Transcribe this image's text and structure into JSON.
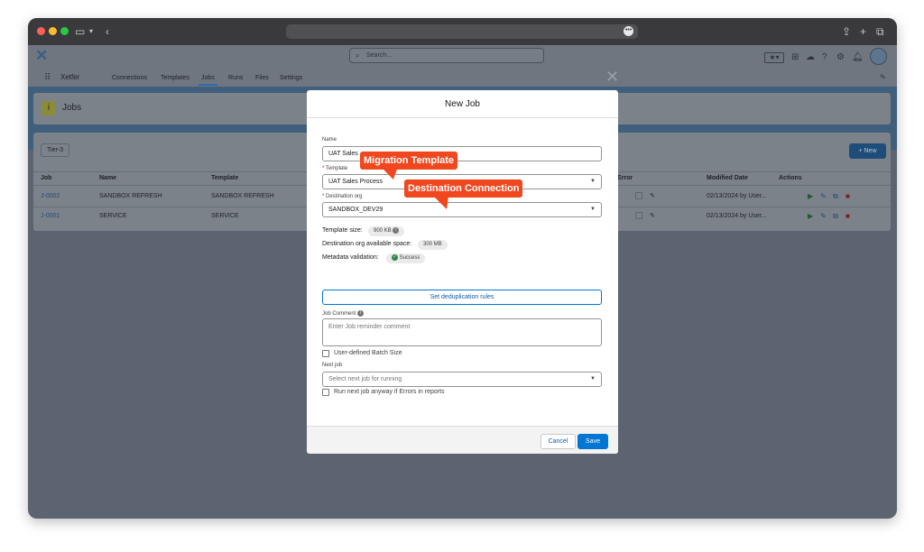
{
  "browser": {
    "traffic_lights": [
      "#fe5f57",
      "#febc2e",
      "#28c840"
    ],
    "icons": [
      "sidebar-icon",
      "chevron-down-icon",
      "back-icon",
      "more-icon",
      "share-icon",
      "new-tab-icon",
      "tabs-icon"
    ]
  },
  "header": {
    "app_name": "Xetfer",
    "search_placeholder": "Search...",
    "nav_tabs": [
      {
        "label": "Connections",
        "active": false
      },
      {
        "label": "Templates",
        "active": false
      },
      {
        "label": "Jobs",
        "active": true
      },
      {
        "label": "Runs",
        "active": false
      },
      {
        "label": "Files",
        "active": false
      },
      {
        "label": "Settings",
        "active": false
      }
    ]
  },
  "page": {
    "title": "Jobs",
    "filter_chip": "Tier-3",
    "new_button": "+ New",
    "columns": [
      "Job",
      "Name",
      "Template",
      "Error",
      "Modified Date",
      "Actions"
    ],
    "rows": [
      {
        "job": "J-0002",
        "name": "SANDBOX REFRESH",
        "template": "SANDBOX REFRESH",
        "modified": "02/13/2024 by User..."
      },
      {
        "job": "J-0001",
        "name": "SERVICE",
        "template": "SERVICE",
        "modified": "02/13/2024 by User..."
      }
    ]
  },
  "modal": {
    "title": "New Job",
    "name_label": "Name",
    "name_value": "UAT Sales",
    "template_label": "Template",
    "template_value": "UAT Sales Process",
    "dest_label": "Destination org",
    "dest_value": "SANDBOX_DEV29",
    "template_size_label": "Template size:",
    "template_size_value": "900 KB",
    "available_space_label": "Destination org available space:",
    "available_space_value": "300 MB",
    "metadata_label": "Metadata validation:",
    "metadata_value": "Success",
    "dedup_button": "Set deduplication rules",
    "comment_label": "Job Comment",
    "comment_placeholder": "Enter Job reminder comment",
    "batch_label": "User-defined Batch Size",
    "next_job_label": "Next job",
    "next_job_placeholder": "Select next job for running",
    "run_anyway_label": "Run next job anyway if Errors in reports",
    "cancel": "Cancel",
    "save": "Save"
  },
  "annotations": {
    "callout_template": "Migration Template",
    "callout_destination": "Destination Connection",
    "color": "#f0471f"
  }
}
